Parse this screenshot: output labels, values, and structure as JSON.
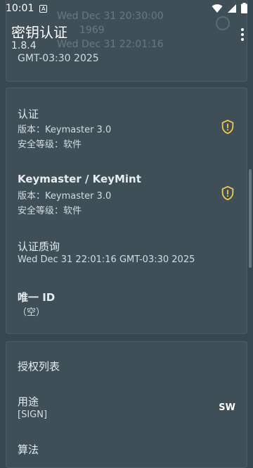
{
  "status": {
    "time": "10:01",
    "notification_badge": "A"
  },
  "app": {
    "title": "密钥认证",
    "version": "1.8.4"
  },
  "ghost": {
    "line1": "Wed Dec 31 20:30:00",
    "line2": "1969",
    "line3": "Wed Dec 31 22:01:16",
    "line4": "GMT-03:30 2025"
  },
  "card_main": {
    "attestation": {
      "title": "认证",
      "version": "版本：Keymaster 3.0",
      "security": "安全等级：软件"
    },
    "keymaster": {
      "title": "Keymaster / KeyMint",
      "version": "版本：Keymaster 3.0",
      "security": "安全等级：软件"
    },
    "challenge": {
      "title": "认证质询",
      "value": "Wed Dec 31 22:01:16 GMT-03:30 2025"
    },
    "unique_id": {
      "title": "唯一 ID",
      "value": "（空）"
    }
  },
  "card_auth": {
    "title": "授权列表",
    "purpose": {
      "title": "用途",
      "value": "[SIGN]",
      "badge": "SW"
    },
    "algorithm": {
      "title": "算法"
    }
  },
  "colors": {
    "background": "#37474f",
    "card": "#3e4f58",
    "warning": "#f5c842"
  }
}
